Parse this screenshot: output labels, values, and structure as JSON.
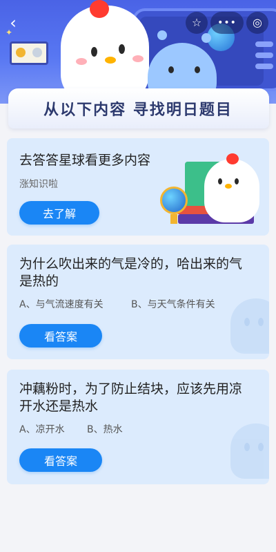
{
  "header": {
    "back_icon": "chevron-left-icon",
    "capsule": {
      "favorite_icon": "star-icon",
      "more_label": "•••",
      "close_icon": "target-icon"
    }
  },
  "banner": {
    "title": "从以下内容 寻找明日题目"
  },
  "promo_card": {
    "title": "去答答星球看更多内容",
    "subtitle": "涨知识啦",
    "button_label": "去了解"
  },
  "questions": [
    {
      "title_line1": "为什么吹出来的气是冷的，哈出来的气",
      "title_line2": "是热的",
      "option_a": "A、与气流速度有关",
      "option_b": "B、与天气条件有关",
      "button_label": "看答案"
    },
    {
      "title_line1": "冲藕粉时，为了防止结块，应该先用凉",
      "title_line2": "开水还是热水",
      "option_a": "A、凉开水",
      "option_b": "B、热水",
      "button_label": "看答案"
    }
  ],
  "colors": {
    "header_blue": "#4a63e6",
    "card_bg": "#dcebfd",
    "button_blue": "#1a86f5",
    "page_bg": "#f3f4f8"
  }
}
